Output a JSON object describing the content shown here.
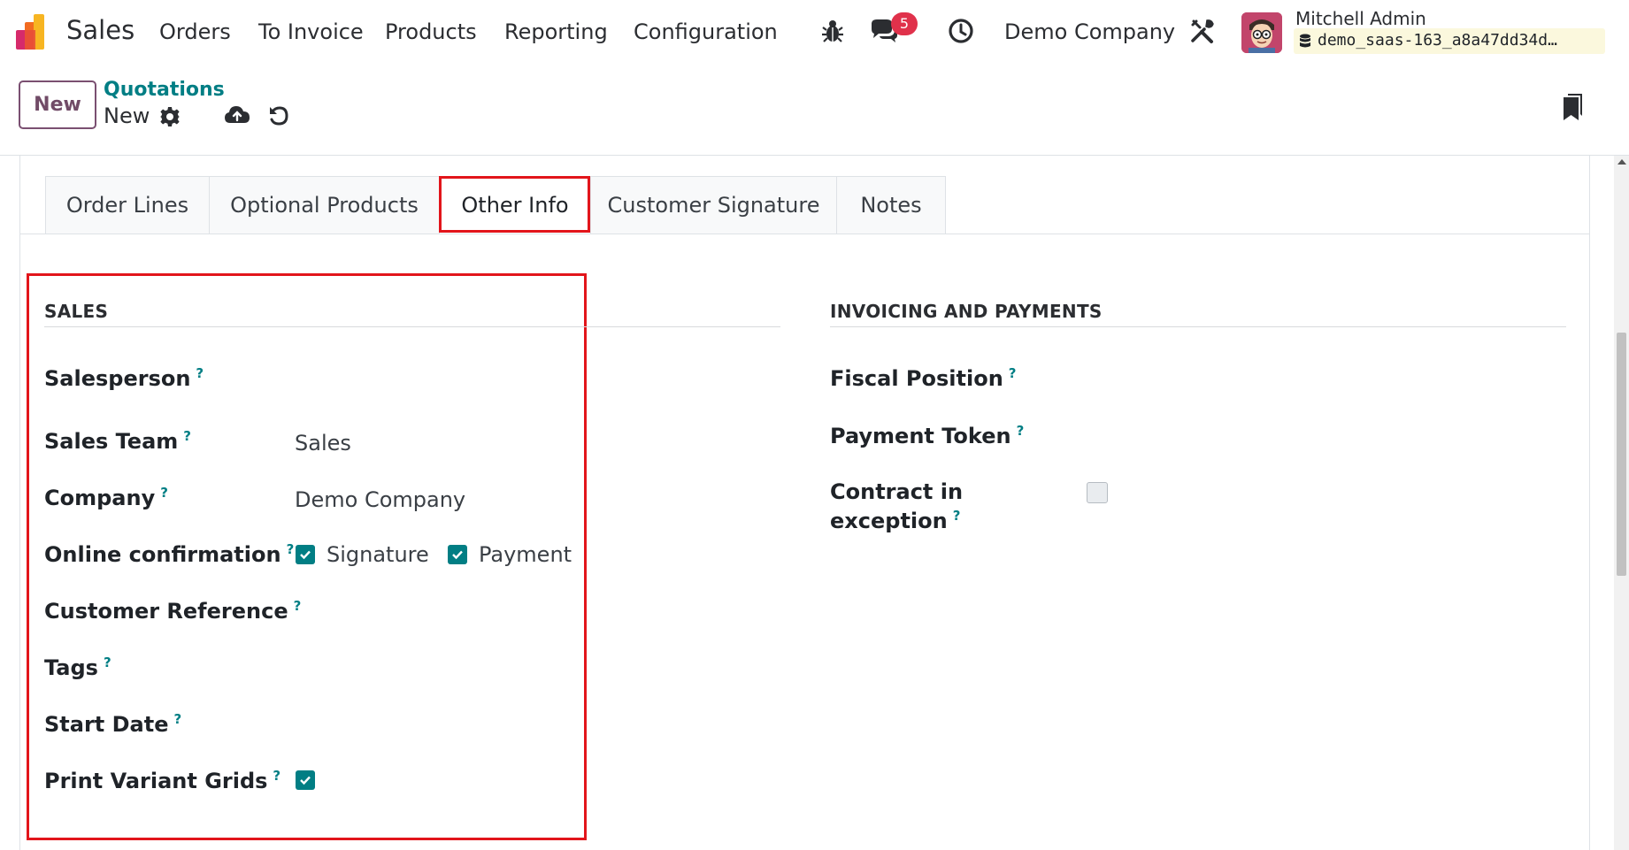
{
  "navbar": {
    "app_name": "Sales",
    "menus": [
      "Orders",
      "To Invoice",
      "Products",
      "Reporting",
      "Configuration"
    ],
    "messages_count": "5",
    "company": "Demo Company",
    "user": {
      "name": "Mitchell Admin",
      "database": "demo_saas-163_a8a47dd34d…"
    },
    "icons": [
      "app-logo-icon",
      "bug-icon",
      "chat-icon",
      "clock-icon",
      "tools-icon",
      "database-icon"
    ]
  },
  "control_panel": {
    "new_button": "New",
    "breadcrumb": "Quotations",
    "record_name": "New",
    "icons": [
      "gear-icon",
      "cloud-upload-icon",
      "undo-icon",
      "bookmark-icon"
    ]
  },
  "tabs": [
    {
      "label": "Order Lines",
      "active": false
    },
    {
      "label": "Optional Products",
      "active": false
    },
    {
      "label": "Other Info",
      "active": true
    },
    {
      "label": "Customer Signature",
      "active": false
    },
    {
      "label": "Notes",
      "active": false
    }
  ],
  "sales": {
    "title": "SALES",
    "salesperson": {
      "label": "Salesperson",
      "value": ""
    },
    "sales_team": {
      "label": "Sales Team",
      "value": "Sales"
    },
    "company": {
      "label": "Company",
      "value": "Demo Company"
    },
    "online_confirmation": {
      "label": "Online confirmation",
      "signature": {
        "label": "Signature",
        "checked": true
      },
      "payment": {
        "label": "Payment",
        "checked": true
      }
    },
    "customer_reference": {
      "label": "Customer Reference",
      "value": ""
    },
    "tags": {
      "label": "Tags",
      "value": ""
    },
    "start_date": {
      "label": "Start Date",
      "value": ""
    },
    "print_variant_grids": {
      "label": "Print Variant Grids",
      "checked": true
    }
  },
  "invoicing": {
    "title": "INVOICING AND PAYMENTS",
    "fiscal_position": {
      "label": "Fiscal Position",
      "value": ""
    },
    "payment_token": {
      "label": "Payment Token",
      "value": ""
    },
    "contract_exception": {
      "label_line1": "Contract in",
      "label_line2": "exception",
      "checked": false
    }
  },
  "help_marker": "?",
  "colors": {
    "brand": "#714b67",
    "accent": "#017e84",
    "highlight": "#e2151b",
    "badge": "#e0314b",
    "db_chip": "#fbf8dd"
  }
}
